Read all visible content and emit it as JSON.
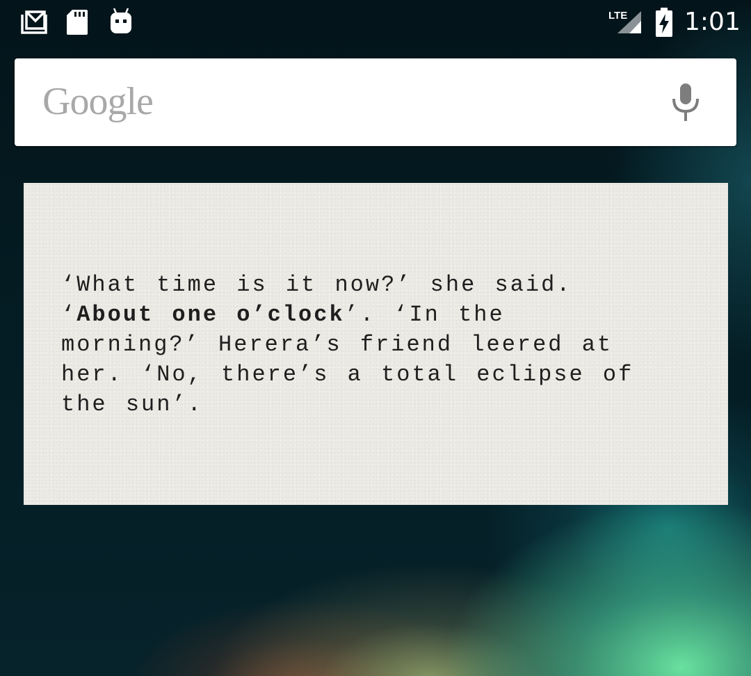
{
  "status_bar": {
    "time": "1:01",
    "network_type": "LTE",
    "notification_icons": [
      "gmail-icon",
      "sd-card-icon",
      "android-icon"
    ],
    "system_icons": [
      "signal-icon",
      "battery-charging-icon"
    ]
  },
  "search_widget": {
    "logo_text": "Google",
    "voice_icon": "microphone-icon"
  },
  "quote_widget": {
    "line_1": "‘What time is it now?’ she said.",
    "line_2_prefix": "‘",
    "line_2_highlight": "About one o’clock",
    "line_2_suffix": "’. ‘In the",
    "line_3": "morning?’ Herera’s friend leered at",
    "line_4": "her. ‘No, there’s a total eclipse of",
    "line_5": "the sun’."
  }
}
